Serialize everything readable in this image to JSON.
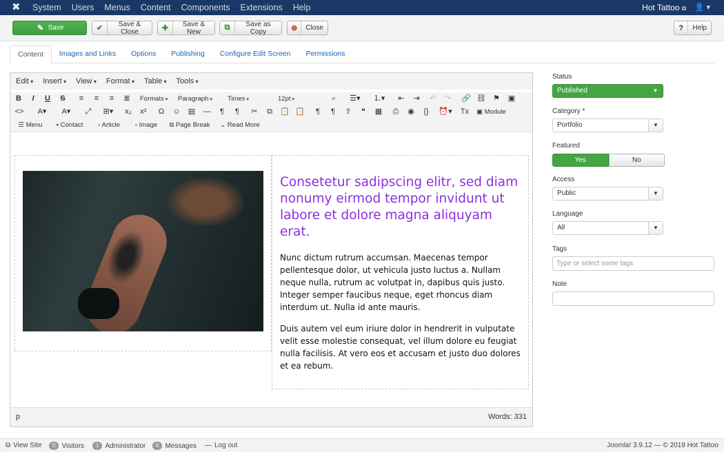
{
  "navbar": {
    "menu": [
      "System",
      "Users",
      "Menus",
      "Content",
      "Components",
      "Extensions",
      "Help"
    ],
    "site_name": "Hot Tattoo"
  },
  "toolbar": {
    "save": "Save",
    "save_close": "Save & Close",
    "save_new": "Save & New",
    "save_copy": "Save as Copy",
    "close": "Close",
    "help": "Help"
  },
  "tabs": [
    "Content",
    "Images and Links",
    "Options",
    "Publishing",
    "Configure Edit Screen",
    "Permissions"
  ],
  "editor": {
    "menubar": [
      "Edit",
      "Insert",
      "View",
      "Format",
      "Table",
      "Tools"
    ],
    "formats": "Formats",
    "block": "Paragraph",
    "font": "Times",
    "size": "12pt",
    "module_btn": "Module",
    "insert_buttons": [
      "Menu",
      "Contact",
      "Article",
      "Image",
      "Page Break",
      "Read More"
    ],
    "heading": "Consetetur sadipscing elitr, sed diam nonumy eirmod tempor invidunt ut labore et dolore magna aliquyam erat.",
    "paragraph1": "Nunc dictum rutrum accumsan. Maecenas tempor pellentesque dolor, ut vehicula justo luctus a. Nullam neque nulla, rutrum ac volutpat in, dapibus quis justo. Integer semper faucibus neque, eget rhoncus diam interdum ut. Nulla id ante mauris.",
    "paragraph2": "Duis autem vel eum iriure dolor in hendrerit in vulputate velit esse molestie consequat, vel illum dolore eu feugiat nulla facilisis. At vero eos et accusam et justo duo dolores et ea rebum.",
    "path": "p",
    "words": "Words: 331"
  },
  "sidebar": {
    "status_label": "Status",
    "status_value": "Published",
    "category_label": "Category *",
    "category_value": "Portfolio",
    "featured_label": "Featured",
    "featured_yes": "Yes",
    "featured_no": "No",
    "access_label": "Access",
    "access_value": "Public",
    "language_label": "Language",
    "language_value": "All",
    "tags_label": "Tags",
    "tags_placeholder": "Type or select some tags",
    "note_label": "Note",
    "note_value": ""
  },
  "footer": {
    "view_site": "View Site",
    "visitors_count": "0",
    "visitors": "Visitors",
    "admin_count": "1",
    "admin": "Administrator",
    "messages_count": "0",
    "messages": "Messages",
    "logout": "Log out",
    "version": "Joomla! 3.9.12",
    "copyright": "— © 2019 Hot Tattoo"
  },
  "colors": {
    "navbar": "#1a3867",
    "success": "#45a545",
    "link": "#1b62b4",
    "heading": "#8e2ee0"
  }
}
